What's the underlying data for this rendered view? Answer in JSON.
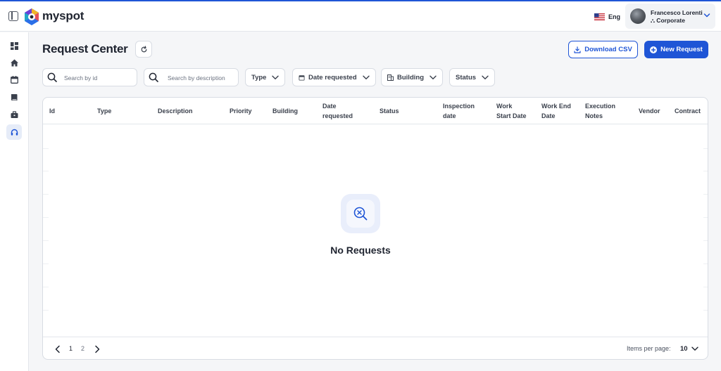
{
  "app": {
    "brand": "myspot"
  },
  "header": {
    "language": "Eng",
    "user_name": "Francesco Lorenti",
    "user_org": "⛬ Corporate"
  },
  "sidebar": {
    "items": [
      {
        "icon": "dashboard-icon",
        "active": false
      },
      {
        "icon": "home-icon",
        "active": false
      },
      {
        "icon": "calendar-icon",
        "active": false
      },
      {
        "icon": "book-icon",
        "active": false
      },
      {
        "icon": "toolbox-icon",
        "active": false
      },
      {
        "icon": "headset-icon",
        "active": true
      }
    ]
  },
  "page": {
    "title": "Request Center",
    "download_label": "Download CSV",
    "new_request_label": "New Request"
  },
  "filters": {
    "search_id_placeholder": "Search by id",
    "search_description_placeholder": "Search by description",
    "type_label": "Type",
    "date_label": "Date requested",
    "building_label": "Building",
    "status_label": "Status"
  },
  "table": {
    "columns": [
      [
        "Id"
      ],
      [
        "Type"
      ],
      [
        "Description"
      ],
      [
        "Priority"
      ],
      [
        "Building"
      ],
      [
        "Date",
        "requested"
      ],
      [
        "Status"
      ],
      [
        "Inspection",
        "date"
      ],
      [
        "Work",
        "Start Date"
      ],
      [
        "Work End",
        "Date"
      ],
      [
        "Execution",
        "Notes"
      ],
      [
        "Vendor"
      ],
      [
        "Contract"
      ]
    ],
    "empty_text": "No Requests"
  },
  "pagination": {
    "pages": [
      "1",
      "2"
    ],
    "items_per_page_label": "Items per page:",
    "items_per_page_value": "10"
  },
  "colors": {
    "accent": "#1f55d6",
    "border": "#d8dce3",
    "text": "#1f2430"
  }
}
